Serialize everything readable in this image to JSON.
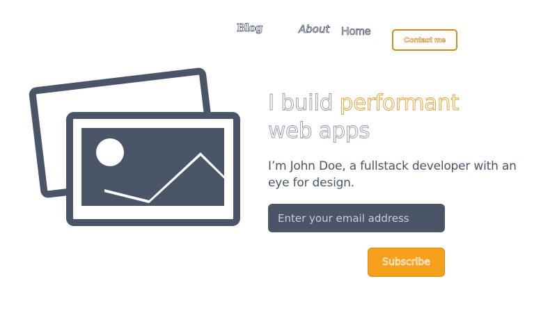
{
  "nav": {
    "items": [
      {
        "label": "Blog"
      },
      {
        "label": "About"
      },
      {
        "label": "Home"
      }
    ],
    "contact_label": "Contact me"
  },
  "hero": {
    "headline_lead": "I build ",
    "headline_accent": "performant",
    "headline_tail": "web apps",
    "tagline": "I’m John Doe, a fullstack developer with an eye for design."
  },
  "form": {
    "email_placeholder": "Enter your email address",
    "email_value": "",
    "subscribe_label": "Subscribe"
  },
  "illustration": {
    "icon": "images-icon"
  },
  "colors": {
    "slate": "#4a5568",
    "accent": "#f7a01b",
    "accent_dark": "#d08a1c"
  }
}
